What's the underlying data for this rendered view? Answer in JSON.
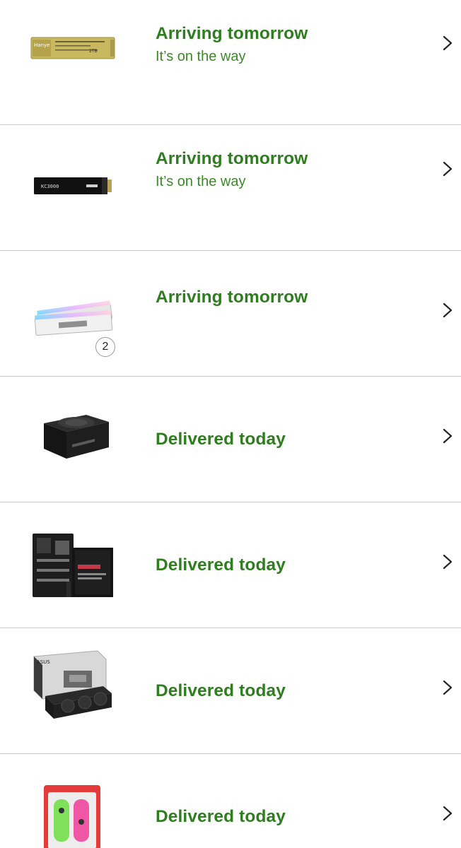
{
  "orders": [
    {
      "status": "Arriving tomorrow",
      "substatus": "It’s on the way",
      "product_icon": "nvme-ssd-hanye-icon",
      "product_label": "Hanye",
      "product_sublabel": "2TB"
    },
    {
      "status": "Arriving tomorrow",
      "substatus": "It’s on the way",
      "product_icon": "nvme-ssd-kingston-icon",
      "product_label": "KC3000"
    },
    {
      "status": "Arriving tomorrow",
      "product_icon": "ram-kit-icon",
      "quantity": "2"
    },
    {
      "status": "Delivered today",
      "product_icon": "power-supply-icon"
    },
    {
      "status": "Delivered today",
      "product_icon": "motherboard-icon"
    },
    {
      "status": "Delivered today",
      "product_icon": "graphics-card-icon",
      "product_label": "ASUS"
    },
    {
      "status": "Delivered today",
      "product_icon": "joy-con-controllers-icon"
    }
  ],
  "colors": {
    "status_green": "#2e7d1f",
    "divider": "#c9c9c9",
    "chevron": "#222222"
  }
}
